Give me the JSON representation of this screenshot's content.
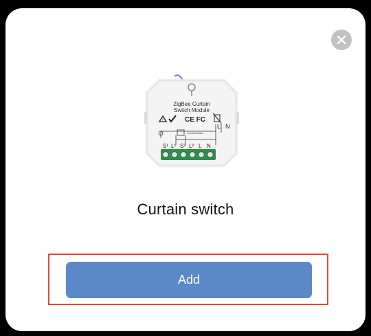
{
  "dialog": {
    "device_name": "Curtain switch",
    "add_label": "Add",
    "close_icon": "close-icon",
    "accent_color": "#5a88c8",
    "highlight_color": "#e5473c"
  },
  "device_image": {
    "title_line1": "ZigBee Curtain",
    "title_line2": "Switch Module",
    "cert_marks": "CE FC",
    "wiring_label": "Curtain Motor",
    "top_terminals": [
      "L",
      "N"
    ],
    "bottom_terminals": [
      "S¹",
      "L¹",
      "S²",
      "L²",
      "L",
      "N"
    ]
  }
}
